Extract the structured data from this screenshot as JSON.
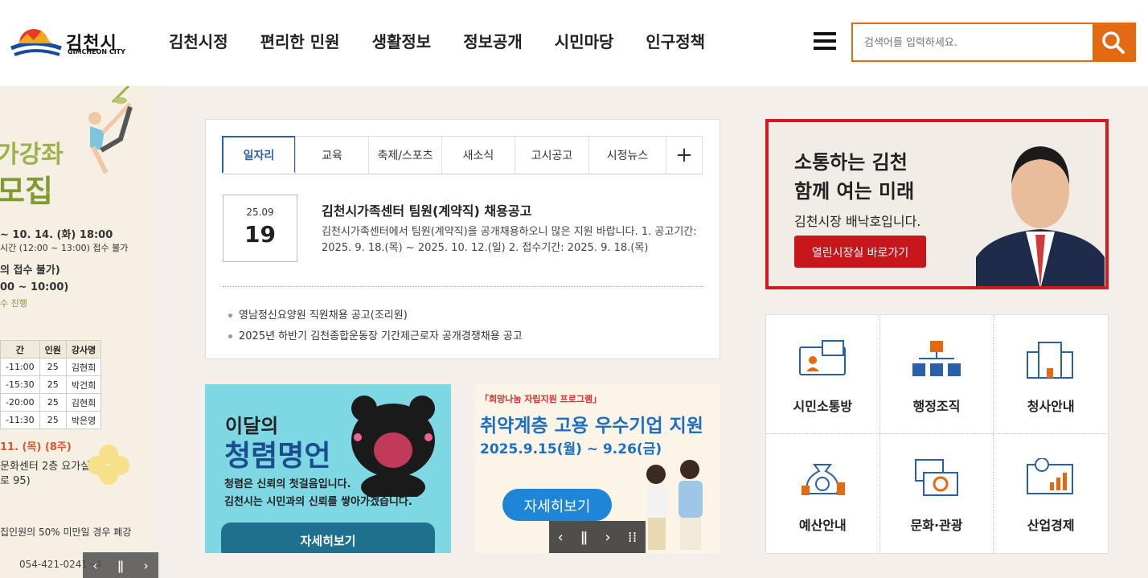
{
  "header": {
    "logo_text": "김천시",
    "logo_sub": "GIMCHEON CITY",
    "nav": [
      "김천시정",
      "편리한 민원",
      "생활정보",
      "정보공개",
      "시민마당",
      "인구정책"
    ],
    "search_placeholder": "검색어를 입력하세요."
  },
  "left_banner": {
    "title1": "가강좌",
    "title2": "모집",
    "lines": [
      "~ 10. 14. (화) 18:00",
      "시간 (12:00 ~ 13:00) 접수 불가",
      "의 접수 불가)",
      "00 ~ 10:00)",
      "수 진행"
    ],
    "table_headers": [
      "간",
      "인원",
      "강사명"
    ],
    "table_rows": [
      [
        "-11:00",
        "25",
        "김현희"
      ],
      [
        "-15:30",
        "25",
        "박건희"
      ],
      [
        "-20:00",
        "25",
        "김현희"
      ],
      [
        "-11:30",
        "25",
        "박은영"
      ]
    ],
    "date_line": "11. (목) (8주)",
    "place1": "문화센터 2층 요가실",
    "place2": "로 95)",
    "note": "집인원의 50% 미만일 경우 폐강",
    "phone": "054-421-0241~4"
  },
  "board": {
    "tabs": [
      "일자리",
      "교육",
      "축제/스포츠",
      "새소식",
      "고시공고",
      "시정뉴스"
    ],
    "more": "+",
    "featured": {
      "ym": "25.09",
      "day": "19",
      "title": "김천시가족센터 팀원(계약직) 채용공고",
      "desc": "김천시가족센터에서 팀원(계약직)을 공개채용하오니 많은 지원 바랍니다. 1. 공고기간: 2025. 9. 18.(목) ~ 2025. 10. 12.(일) 2. 접수기간: 2025. 9. 18.(목)"
    },
    "list": [
      "영남정신요양원 직원채용 공고(조리원)",
      "2025년 하반기 김천종합운동장 기간제근로자 공개경쟁채용 공고"
    ]
  },
  "banner1": {
    "title1": "이달의",
    "title2": "청렴명언",
    "line1": "청렴은 신뢰의 첫걸음입니다.",
    "line2": "김천시는 시민과의 신뢰를 쌓아가겠습니다.",
    "button": "자세히보기"
  },
  "banner2": {
    "tag": "「희망나눔 자립지원 프로그램」",
    "title": "취약계층 고용 우수기업 지원",
    "date": "2025.9.15(월) ~ 9.26(금)",
    "button": "자세히보기"
  },
  "mayor": {
    "line1": "소통하는 김천",
    "line2": "함께 여는 미래",
    "sub": "김천시장 배낙호입니다.",
    "button": "열린시장실 바로가기"
  },
  "quick_links": [
    "시민소통방",
    "행정조직",
    "청사안내",
    "예산안내",
    "문화·관광",
    "산업경제"
  ],
  "colors": {
    "accent": "#e46a12",
    "mayor_red": "#d7191f",
    "tab_blue": "#2b5fa8"
  }
}
